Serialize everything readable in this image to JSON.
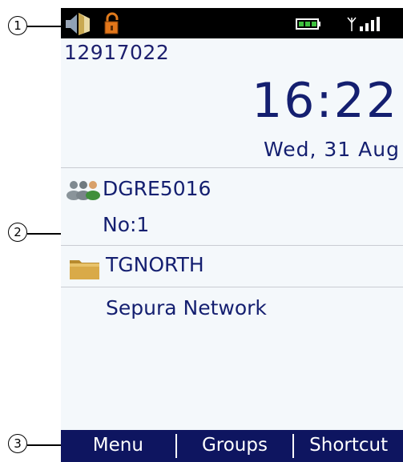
{
  "callouts": [
    "1",
    "2",
    "3"
  ],
  "status_bar": {
    "icons": [
      "speaker-icon",
      "unlock-icon",
      "battery-icon",
      "signal-icon"
    ]
  },
  "home": {
    "ssi": "12917022",
    "time": "16:22",
    "date": "Wed, 31 Aug",
    "talkgroup": "DGRE5016",
    "talkgroup_number": "No:1",
    "folder": "TGNORTH",
    "network": "Sepura Network"
  },
  "softkeys": {
    "left": "Menu",
    "middle": "Groups",
    "right": "Shortcut"
  },
  "colors": {
    "screen_bg": "#f4f8fb",
    "text": "#141f70",
    "softkey_bar": "#0e1560",
    "status_bar": "#000000"
  }
}
